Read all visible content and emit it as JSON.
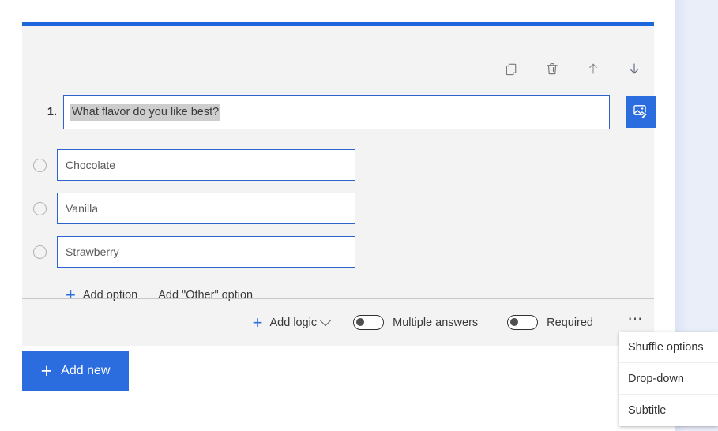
{
  "theme": {
    "accent_blue": "#2b6cdf",
    "card_accent_bar": "#1f66dc",
    "card_background": "#f3f3f3",
    "right_panel": "#e9eef9"
  },
  "card_toolbar": {
    "copy": {
      "label": "Copy question",
      "icon": "copy-icon"
    },
    "delete": {
      "label": "Delete question",
      "icon": "trash-icon"
    },
    "move_up": {
      "label": "Move question up",
      "icon": "arrow-up-icon"
    },
    "move_down": {
      "label": "Move question down",
      "icon": "arrow-down-icon"
    }
  },
  "question": {
    "number": "1.",
    "text": "What flavor do you like best?",
    "text_selected": true,
    "media_button_icon": "insert-media-icon"
  },
  "options": [
    {
      "value": "Chocolate",
      "selected": false
    },
    {
      "value": "Vanilla",
      "selected": false
    },
    {
      "value": "Strawberry",
      "selected": false
    }
  ],
  "add_row": {
    "add_option_label": "Add option",
    "add_other_label": "Add \"Other\" option",
    "plus_icon": "plus-icon"
  },
  "footer": {
    "add_logic_label": "Add logic",
    "add_logic_chevron": "chevron-down-icon",
    "multiple_answers": {
      "label": "Multiple answers",
      "on": false
    },
    "required": {
      "label": "Required",
      "on": false
    },
    "more_options_icon": "ellipsis-icon"
  },
  "context_menu": {
    "items": [
      {
        "label": "Shuffle options"
      },
      {
        "label": "Drop-down"
      },
      {
        "label": "Subtitle"
      }
    ]
  },
  "add_new": {
    "label": "Add new",
    "plus_icon": "plus-icon"
  }
}
